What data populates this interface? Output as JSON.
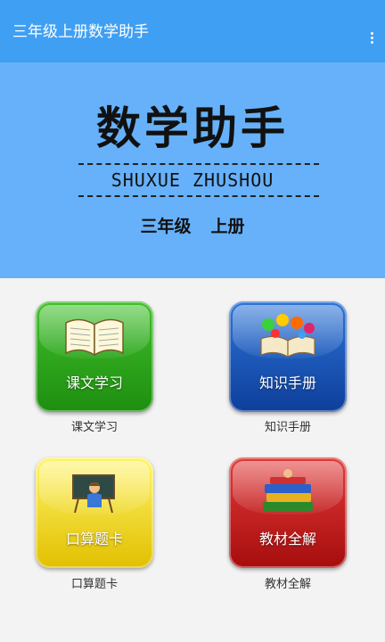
{
  "app_bar": {
    "title": "三年级上册数学助手",
    "menu_icon": "more-vert-icon"
  },
  "banner": {
    "title": "数学助手",
    "subtitle": "SHUXUE ZHUSHOU",
    "grade": "三年级",
    "volume": "上册"
  },
  "tiles": [
    {
      "label": "课文学习",
      "caption": "课文学习",
      "icon": "open-book-icon",
      "color": "#2aa91a"
    },
    {
      "label": "知识手册",
      "caption": "知识手册",
      "icon": "numbers-book-icon",
      "color": "#1a55bb"
    },
    {
      "label": "口算题卡",
      "caption": "口算题卡",
      "icon": "student-at-board-icon",
      "color": "#f3dc1a"
    },
    {
      "label": "教材全解",
      "caption": "教材全解",
      "icon": "book-stack-icon",
      "color": "#c81e1e"
    }
  ]
}
